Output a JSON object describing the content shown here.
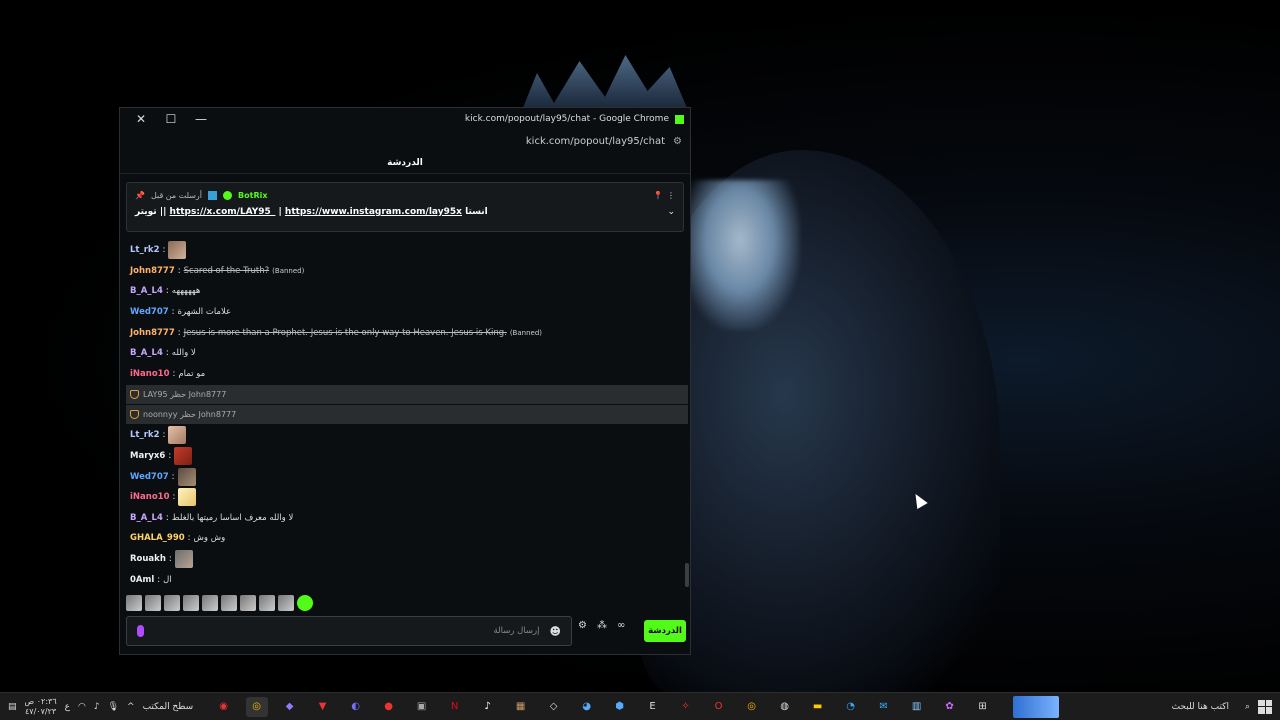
{
  "window": {
    "title": "kick.com/popout/lay95/chat - Google Chrome",
    "url": "kick.com/popout/lay95/chat",
    "controls": {
      "close": "✕",
      "maximize": "☐",
      "minimize": "—"
    }
  },
  "chat": {
    "header": "الدردشة",
    "pinned": {
      "label": "أرسلت من قبل",
      "user": "BotRix",
      "message_prefix": "تويتر ||",
      "link1": "https://x.com/LAY95_",
      "separator": "|",
      "link2": "https://www.instagram.com/lay95x",
      "message_suffix": "انستا"
    },
    "messages": [
      {
        "user": "Lt_rk2",
        "text": "",
        "emote": "e1",
        "color": "c-blue"
      },
      {
        "user": "John8777",
        "text": "Scared of the Truth?",
        "strike": true,
        "banned": "(Banned)",
        "color": "c-orange"
      },
      {
        "user": "B_A_L4",
        "text": "ههههههه",
        "color": "c-purple"
      },
      {
        "user": "Wed707",
        "text": "علامات الشهرة",
        "color": "c-sky"
      },
      {
        "user": "John8777",
        "text": "Jesus is more than a Prophet. Jesus is the only way to Heaven. Jesus is King.",
        "strike": true,
        "banned": "(Banned)",
        "color": "c-orange"
      },
      {
        "user": "B_A_L4",
        "text": "لا والله",
        "color": "c-purple"
      },
      {
        "user": "iNano10",
        "text": "مو تمام",
        "color": "c-pink"
      }
    ],
    "mod_actions": [
      {
        "text": "LAY95 حظر John8777"
      },
      {
        "text": "noonnyy حظر John8777"
      }
    ],
    "messages2": [
      {
        "user": "Lt_rk2",
        "color": "c-blue",
        "emote": "e2"
      },
      {
        "user": "Maryx6",
        "color": "c-white",
        "emote": "e3"
      },
      {
        "user": "Wed707",
        "color": "c-sky",
        "emote": "e4"
      },
      {
        "user": "iNano10",
        "color": "c-pink",
        "emote": "e5"
      },
      {
        "user": "B_A_L4",
        "text": "لا والله معرف اساسا رميتها بالغلط",
        "color": "c-purple"
      },
      {
        "user": "GHALA_990",
        "text": "وش وش",
        "color": "c-yellow"
      },
      {
        "user": "Rouakh",
        "color": "c-white",
        "emote": "e6"
      },
      {
        "user": "0Aml",
        "text": "ال",
        "color": "c-white"
      }
    ],
    "input_placeholder": "إرسال رسالة",
    "send_button": "الدردشة"
  },
  "taskbar": {
    "search_placeholder": "اكتب هنا للبحث",
    "desktop_label": "سطح المكتب",
    "time": "٠٢:٣٦ ص",
    "date": "٤٧/٠٧/٢٣",
    "lang": "ع"
  },
  "colors": {
    "kick_green": "#53fc18"
  }
}
